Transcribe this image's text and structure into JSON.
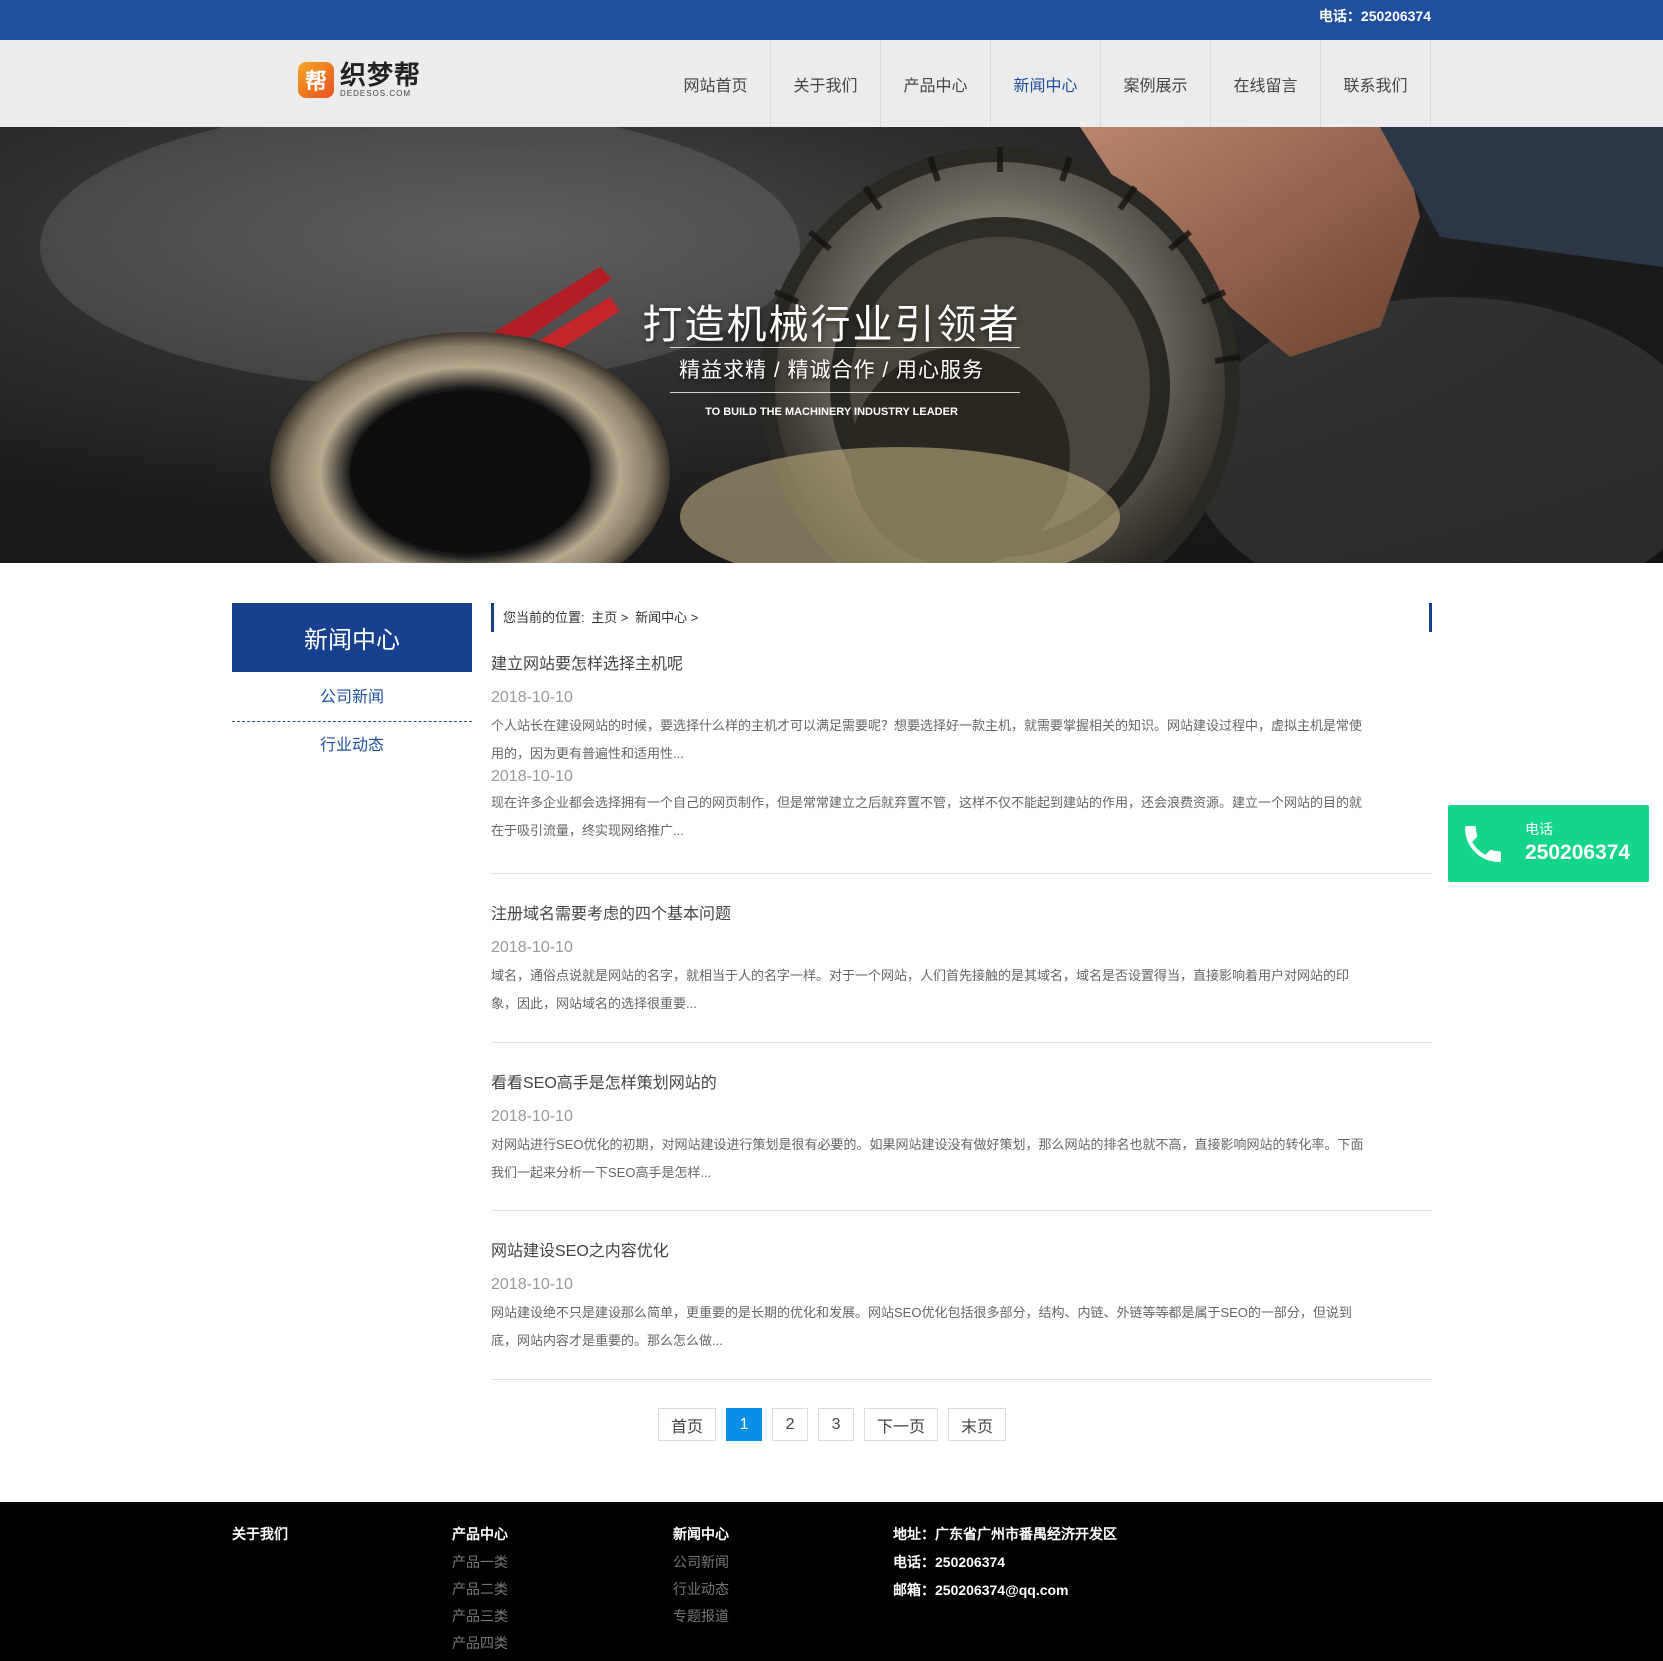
{
  "topbar": {
    "phone": "电话：250206374"
  },
  "logo": {
    "badge": "帮",
    "name": "织梦帮",
    "domain": "DEDESOS.COM"
  },
  "nav": {
    "items": [
      "网站首页",
      "关于我们",
      "产品中心",
      "新闻中心",
      "案例展示",
      "在线留言",
      "联系我们"
    ],
    "active": "新闻中心"
  },
  "banner": {
    "title": "打造机械行业引领者",
    "subtitle": "精益求精 / 精诚合作 / 用心服务",
    "english": "TO BUILD THE MACHINERY INDUSTRY LEADER"
  },
  "sidebar": {
    "heading": "新闻中心",
    "items": [
      {
        "label": "公司新闻"
      },
      {
        "label": "行业动态"
      }
    ]
  },
  "breadcrumb": {
    "prefix": "您当前的位置:",
    "home": "主页",
    "sep": ">",
    "current": "新闻中心"
  },
  "articles": [
    {
      "title": "建立网站要怎样选择主机呢",
      "date": "2018-10-10",
      "desc1": "个人站长在建设网站的时候，要选择什么样的主机才可以满足需要呢？想要选择好一款主机，就需要掌握相关的知识。网站建设过程中，虚拟主机是常使",
      "desc2": "用的，因为更有普遍性和适用性..."
    },
    {
      "title": "",
      "date": "2018-10-10",
      "desc1": "现在许多企业都会选择拥有一个自己的网页制作，但是常常建立之后就弃置不管，这样不仅不能起到建站的作用，还会浪费资源。建立一个网站的目的就",
      "desc2": "在于吸引流量，终实现网络推广..."
    },
    {
      "title": "注册域名需要考虑的四个基本问题",
      "date": "2018-10-10",
      "desc1": "域名，通俗点说就是网站的名字，就相当于人的名字一样。对于一个网站，人们首先接触的是其域名，域名是否设置得当，直接影响着用户对网站的印",
      "desc2": "象，因此，网站域名的选择很重要..."
    },
    {
      "title": "看看SEO高手是怎样策划网站的",
      "date": "2018-10-10",
      "desc1": "对网站进行SEO优化的初期，对网站建设进行策划是很有必要的。如果网站建设没有做好策划，那么网站的排名也就不高，直接影响网站的转化率。下面",
      "desc2": "我们一起来分析一下SEO高手是怎样..."
    },
    {
      "title": "网站建设SEO之内容优化",
      "date": "2018-10-10",
      "desc1": "网站建设绝不只是建设那么简单，更重要的是长期的优化和发展。网站SEO优化包括很多部分，结构、内链、外链等等都是属于SEO的一部分，但说到",
      "desc2": "底，网站内容才是重要的。那么怎么做..."
    }
  ],
  "pagination": {
    "first": "首页",
    "pages": [
      "1",
      "2",
      "3"
    ],
    "current": "1",
    "next": "下一页",
    "last": "末页"
  },
  "float_phone": {
    "label": "电话",
    "number": "250206374",
    "icon": "phone-icon",
    "color": "#13d68a"
  },
  "footer": {
    "col1": {
      "heading": "关于我们"
    },
    "col2": {
      "heading": "产品中心",
      "links": [
        "产品一类",
        "产品二类",
        "产品三类",
        "产品四类"
      ]
    },
    "col3": {
      "heading": "新闻中心",
      "links": [
        "公司新闻",
        "行业动态",
        "专题报道"
      ]
    },
    "contact": {
      "address": "地址：广东省广州市番禺经济开发区",
      "phone": "电话：250206374",
      "email": "邮箱：250206374@qq.com"
    }
  },
  "colors": {
    "primary": "#1f4f9f",
    "sidebar_head": "#17408f",
    "pager_active": "#0a8fe6",
    "footer_bg": "#000000"
  }
}
